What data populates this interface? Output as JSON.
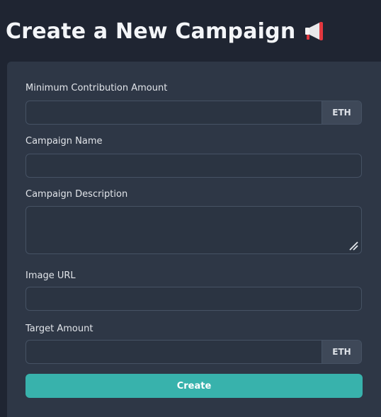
{
  "header": {
    "title": "Create a New Campaign",
    "icon": "megaphone-icon"
  },
  "form": {
    "min_contribution": {
      "label": "Minimum Contribution Amount",
      "value": "",
      "addon": "ETH"
    },
    "campaign_name": {
      "label": "Campaign Name",
      "value": ""
    },
    "campaign_description": {
      "label": "Campaign Description",
      "value": ""
    },
    "image_url": {
      "label": "Image URL",
      "value": ""
    },
    "target_amount": {
      "label": "Target Amount",
      "value": "",
      "addon": "ETH"
    },
    "submit_label": "Create"
  },
  "colors": {
    "background": "#1f2532",
    "card": "#2e3746",
    "accent": "#38b2ac",
    "field_border": "#465264"
  }
}
